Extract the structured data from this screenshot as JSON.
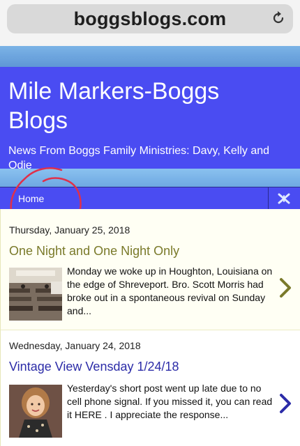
{
  "browser": {
    "url": "boggsblogs.com",
    "reload_icon": "reload-icon"
  },
  "blog": {
    "title": "Mile Markers-Boggs Blogs",
    "description": "News From Boggs Family Ministries: Davy, Kelly and Odie"
  },
  "nav": {
    "home_label": "Home",
    "toggle_icon": "menu-toggle-icon"
  },
  "colors": {
    "header_bg": "#4a4cf2",
    "post1_title": "#7a7a2a",
    "post2_title": "#2c2ca8",
    "annotation": "#e0304a"
  },
  "posts": [
    {
      "date": "Thursday, January 25, 2018",
      "title": "One Night and One Night Only",
      "snippet": "Monday we woke up in Houghton, Louisiana on the edge of Shreveport. Bro. Scott Morris had broke out in a spontaneous revival on Sunday and...",
      "thumbnail": "church-interior-photo",
      "arrow_icon": "chevron-right-icon"
    },
    {
      "date": "Wednesday, January 24, 2018",
      "title": "Vintage View Vensday 1/24/18",
      "snippet": "Yesterday's short post went up late due to no cell phone signal. If you missed it, you can read it HERE . I appreciate the response...",
      "thumbnail": "child-portrait-photo",
      "arrow_icon": "chevron-right-icon"
    }
  ]
}
